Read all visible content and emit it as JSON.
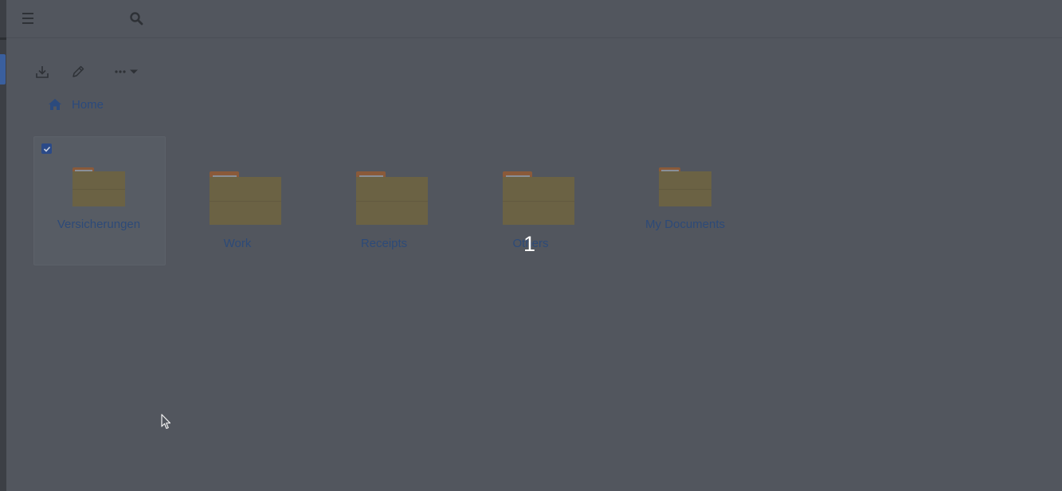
{
  "breadcrumb": {
    "home_label": "Home"
  },
  "folders": [
    {
      "name": "Versicherungen",
      "selected": true
    },
    {
      "name": "Work",
      "selected": false
    },
    {
      "name": "Receipts",
      "selected": false
    },
    {
      "name": "Others",
      "selected": false
    },
    {
      "name": "My Documents",
      "selected": false
    }
  ],
  "overlay": {
    "step_number": "1"
  },
  "icons": {
    "menu": "hamburger-icon",
    "search": "search-icon",
    "download": "download-icon",
    "edit": "pencil-icon",
    "more": "ellipsis-icon",
    "home": "home-icon",
    "folder": "folder-icon",
    "checkbox": "checkbox-checked-icon",
    "cursor": "mouse-pointer-icon"
  },
  "colors": {
    "background": "#52565e",
    "link": "#2d4a78",
    "folder_body": "#6b6244",
    "folder_tab": "#8a5a3a",
    "checkbox": "#2b4a88"
  }
}
